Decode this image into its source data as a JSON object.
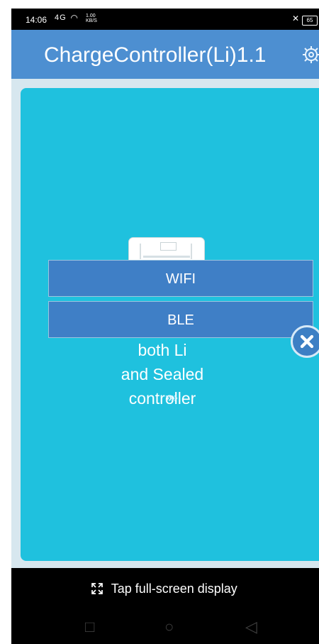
{
  "status_bar": {
    "time": "14:06",
    "signal": "4G",
    "speed_value": "1.00",
    "speed_unit": "KB/S",
    "battery": "65"
  },
  "header": {
    "title": "ChargeController(Li)1.1",
    "settings_icon": "gear-icon"
  },
  "main": {
    "product_text": {
      "line1": "both Li",
      "line2": "and Sealed",
      "line3": "controller"
    },
    "arrows": "»»"
  },
  "dialog": {
    "options": [
      {
        "label": "WIFI"
      },
      {
        "label": "BLE"
      }
    ],
    "close_icon": "close-icon"
  },
  "bottom_bar": {
    "fullscreen_label": "Tap full-screen display"
  },
  "colors": {
    "header": "#4d8fd1",
    "content": "#1fc1de",
    "dialog": "#3f7fc6",
    "bottom": "#000000"
  }
}
